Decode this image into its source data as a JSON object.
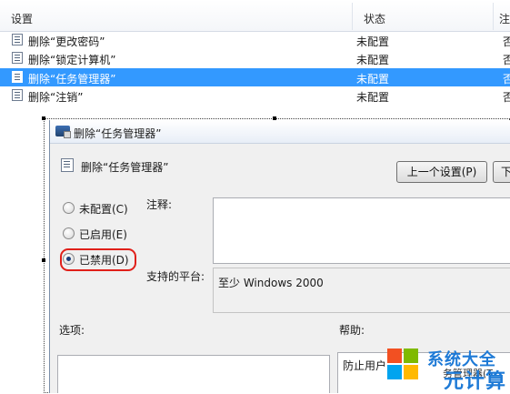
{
  "policy_list": {
    "columns": [
      "设置",
      "状态",
      "注"
    ],
    "rows": [
      {
        "name": "删除“更改密码”",
        "state": "未配置",
        "note": "否",
        "selected": false
      },
      {
        "name": "删除“锁定计算机”",
        "state": "未配置",
        "note": "否",
        "selected": false
      },
      {
        "name": "删除“任务管理器”",
        "state": "未配置",
        "note": "否",
        "selected": true
      },
      {
        "name": "删除“注销”",
        "state": "未配置",
        "note": "否",
        "selected": false
      }
    ]
  },
  "dialog": {
    "title": "删除“任务管理器”",
    "setting_name": "删除“任务管理器”",
    "prev_button": "上一个设置(P)",
    "next_button": "下",
    "radio_options": [
      {
        "label": "未配置(C)",
        "checked": false
      },
      {
        "label": "已启用(E)",
        "checked": false
      },
      {
        "label": "已禁用(D)",
        "checked": true
      }
    ],
    "comment_label": "注释:",
    "platform_label": "支持的平台:",
    "platform_value": "至少 Windows 2000",
    "options_label": "选项:",
    "help_label": "帮助:",
    "help_text_partial": "防止用户",
    "help_text_partial2": "务管理器(T"
  },
  "watermark": {
    "line1": "系统大全",
    "line2": "元计算",
    "colors": [
      "#f25022",
      "#7fba00",
      "#00a4ef",
      "#ffb900"
    ]
  },
  "colors": {
    "selection": "#3399ff",
    "highlight_ring": "#e0201a"
  }
}
